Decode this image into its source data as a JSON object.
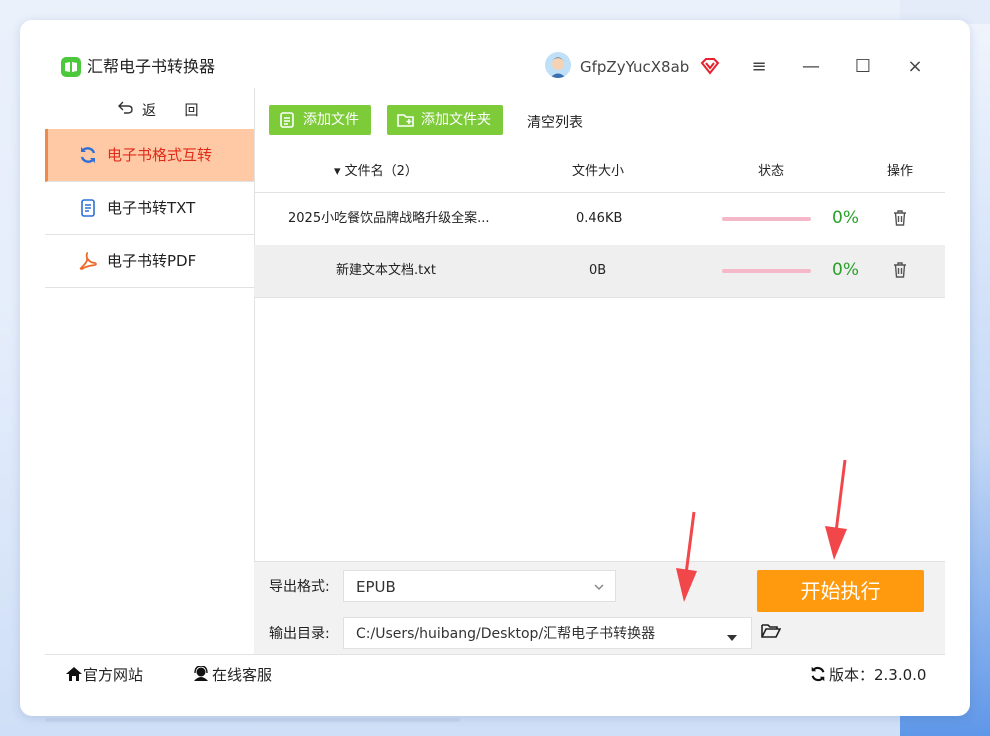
{
  "app": {
    "title": "汇帮电子书转换器"
  },
  "user": {
    "name": "GfpZyYucX8ab"
  },
  "window_controls": {
    "menu": "≡",
    "minimize": "—",
    "maximize": "☐",
    "close": "×"
  },
  "sidebar": {
    "back_label": "返 回",
    "items": [
      {
        "label": "电子书格式互转",
        "icon": "refresh-icon",
        "active": true
      },
      {
        "label": "电子书转TXT",
        "icon": "document-icon",
        "active": false
      },
      {
        "label": "电子书转PDF",
        "icon": "pdf-icon",
        "active": false
      }
    ]
  },
  "toolbar": {
    "add_file": "添加文件",
    "add_folder": "添加文件夹",
    "clear_list": "清空列表"
  },
  "table": {
    "headers": {
      "name": "▾ 文件名（2）",
      "size": "文件大小",
      "status": "状态",
      "action": "操作"
    },
    "rows": [
      {
        "name": "2025小吃餐饮品牌战略升级全案...",
        "size": "0.46KB",
        "progress": "0%"
      },
      {
        "name": "新建文本文档.txt",
        "size": "0B",
        "progress": "0%"
      }
    ]
  },
  "export": {
    "format_label": "导出格式:",
    "format_value": "EPUB",
    "dir_label": "输出目录:",
    "dir_value": "C:/Users/huibang/Desktop/汇帮电子书转换器"
  },
  "start_button": "开始执行",
  "footer": {
    "website": "官方网站",
    "service": "在线客服",
    "version": "版本：2.3.0.0"
  },
  "colors": {
    "accent_orange": "#ff9a0e",
    "green": "#7ecb3a",
    "active_bg": "#ffc9a5",
    "active_text": "#e02b1a",
    "progress_green": "#2aa02a",
    "arrow_red": "#f2474a"
  }
}
